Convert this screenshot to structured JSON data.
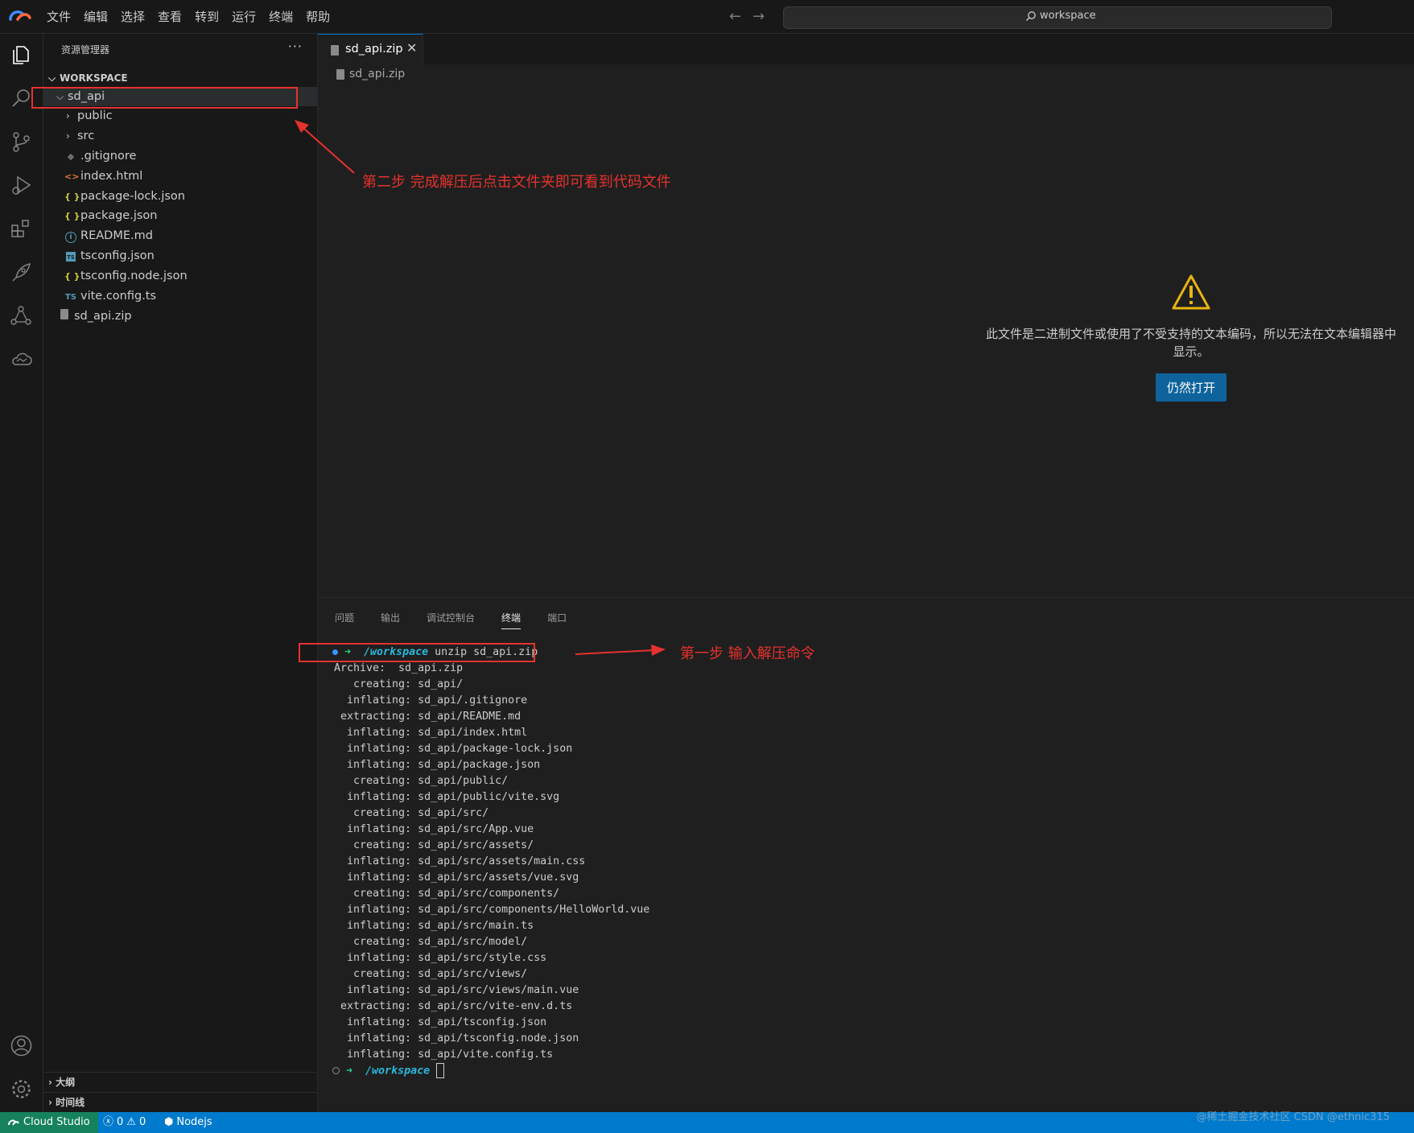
{
  "menu": {
    "items": [
      "文件",
      "编辑",
      "选择",
      "查看",
      "转到",
      "运行",
      "终端",
      "帮助"
    ]
  },
  "command_center": {
    "text": "workspace"
  },
  "activity_bar": {
    "top_icons": [
      "explorer-icon",
      "search-icon",
      "source-control-icon",
      "run-debug-icon",
      "extensions-icon",
      "deploy-rocket-icon",
      "share-icon",
      "cloud-icon"
    ],
    "bottom_icons": [
      "account-icon",
      "settings-gear-icon"
    ]
  },
  "sidebar": {
    "title": "资源管理器",
    "more": "···",
    "workspace_label": "WORKSPACE",
    "tree": [
      {
        "label": "sd_api",
        "kind": "folder-open"
      },
      {
        "label": "public",
        "kind": "folder"
      },
      {
        "label": "src",
        "kind": "folder"
      },
      {
        "label": ".gitignore",
        "kind": "git"
      },
      {
        "label": "index.html",
        "kind": "html"
      },
      {
        "label": "package-lock.json",
        "kind": "json"
      },
      {
        "label": "package.json",
        "kind": "json"
      },
      {
        "label": "README.md",
        "kind": "info"
      },
      {
        "label": "tsconfig.json",
        "kind": "tsconfig"
      },
      {
        "label": "tsconfig.node.json",
        "kind": "json"
      },
      {
        "label": "vite.config.ts",
        "kind": "ts"
      },
      {
        "label": "sd_api.zip",
        "kind": "zip"
      }
    ],
    "icon_glyphs": {
      "json": "{ }",
      "html": "<>",
      "ts": "TS",
      "info": "i",
      "git": "◆",
      "tsconfig": "TS"
    },
    "outline_label": "大纲",
    "timeline_label": "时间线"
  },
  "editor": {
    "tab_label": "sd_api.zip",
    "breadcrumb": "sd_api.zip",
    "warning_message": "此文件是二进制文件或使用了不受支持的文本编码，所以无法在文本编辑器中显示。",
    "open_anyway_label": "仍然打开"
  },
  "panel": {
    "tabs": [
      "问题",
      "输出",
      "调试控制台",
      "终端",
      "端口"
    ],
    "active_tab": "终端",
    "prompt_cwd": "/workspace",
    "command": "unzip sd_api.zip",
    "output": [
      "Archive:  sd_api.zip",
      "   creating: sd_api/",
      "  inflating: sd_api/.gitignore",
      " extracting: sd_api/README.md",
      "  inflating: sd_api/index.html",
      "  inflating: sd_api/package-lock.json",
      "  inflating: sd_api/package.json",
      "   creating: sd_api/public/",
      "  inflating: sd_api/public/vite.svg",
      "   creating: sd_api/src/",
      "  inflating: sd_api/src/App.vue",
      "   creating: sd_api/src/assets/",
      "  inflating: sd_api/src/assets/main.css",
      "  inflating: sd_api/src/assets/vue.svg",
      "   creating: sd_api/src/components/",
      "  inflating: sd_api/src/components/HelloWorld.vue",
      "  inflating: sd_api/src/main.ts",
      "   creating: sd_api/src/model/",
      "  inflating: sd_api/src/style.css",
      "   creating: sd_api/src/views/",
      "  inflating: sd_api/src/views/main.vue",
      " extracting: sd_api/src/vite-env.d.ts",
      "  inflating: sd_api/tsconfig.json",
      "  inflating: sd_api/tsconfig.node.json",
      "  inflating: sd_api/vite.config.ts"
    ]
  },
  "annotations": {
    "step1": "第一步 输入解压命令",
    "step2": "第二步 完成解压后点击文件夹即可看到代码文件",
    "color": "#e5322d"
  },
  "status_bar": {
    "remote_label": "Cloud Studio",
    "errors": "0",
    "warnings": "0",
    "env_label": "Nodejs",
    "watermark": "@稀土掘金技术社区 CSDN @ethnic315"
  },
  "colors": {
    "accent": "#007acc",
    "remote": "#16825d",
    "button": "#0e639c",
    "background": "#1f1f1f"
  }
}
